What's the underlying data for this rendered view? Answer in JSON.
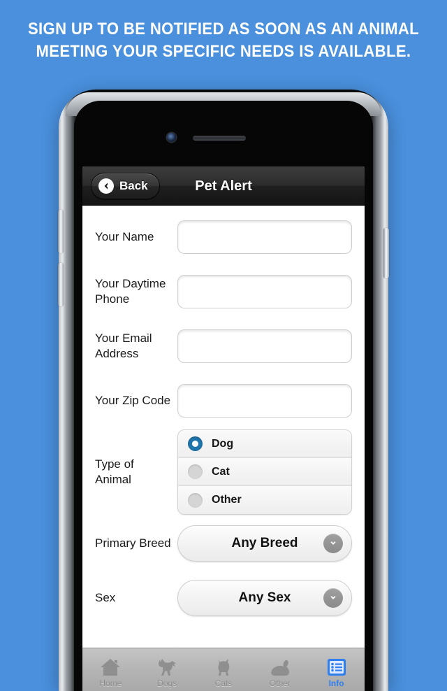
{
  "headline": {
    "line1": "SIGN UP TO BE NOTIFIED AS SOON AS AN ANIMAL",
    "line2": "MEETING YOUR SPECIFIC NEEDS IS AVAILABLE."
  },
  "colors": {
    "background": "#4a90dd",
    "accent": "#2f7ef0",
    "radio_selected": "#1f74ab",
    "navbar": "#2c2c2c",
    "tabbar": "#b4b4b4"
  },
  "navbar": {
    "back_label": "Back",
    "title": "Pet Alert"
  },
  "form": {
    "fields": [
      {
        "label": "Your Name",
        "value": "",
        "placeholder": "",
        "type": "text"
      },
      {
        "label": "Your Daytime Phone",
        "value": "",
        "placeholder": "",
        "type": "text"
      },
      {
        "label": "Your Email Address",
        "value": "",
        "placeholder": "",
        "type": "text"
      },
      {
        "label": "Your Zip Code",
        "value": "",
        "placeholder": "",
        "type": "text"
      }
    ],
    "animal_type": {
      "label": "Type of Animal",
      "options": [
        "Dog",
        "Cat",
        "Other"
      ],
      "selected": "Dog"
    },
    "primary_breed": {
      "label": "Primary Breed",
      "value": "Any Breed"
    },
    "sex": {
      "label": "Sex",
      "value": "Any Sex"
    }
  },
  "tabbar": {
    "items": [
      {
        "label": "Home",
        "icon": "house-icon",
        "active": false
      },
      {
        "label": "Dogs",
        "icon": "dog-icon",
        "active": false
      },
      {
        "label": "Cats",
        "icon": "cat-icon",
        "active": false
      },
      {
        "label": "Other",
        "icon": "rabbit-icon",
        "active": false
      },
      {
        "label": "Info",
        "icon": "list-icon",
        "active": true
      }
    ]
  }
}
